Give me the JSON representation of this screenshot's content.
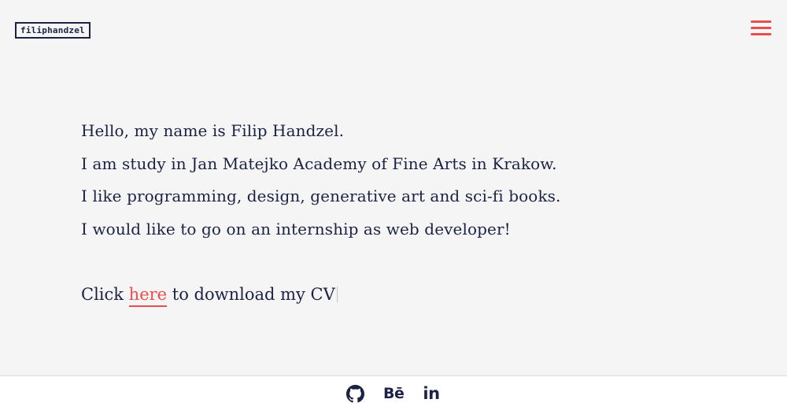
{
  "header": {
    "logo_text": "filiphandzel",
    "menu_icon": "hamburger-menu-icon"
  },
  "intro": {
    "lines": [
      "Hello, my name is Filip Handzel.",
      "I am study in Jan Matejko Academy of Fine Arts in Krakow.",
      "I like programming, design, generative art and sci-fi books.",
      "I would like to go on an internship as web developer!"
    ]
  },
  "cv": {
    "prefix": "Click ",
    "link_text": "here",
    "suffix": " to download my CV"
  },
  "footer": {
    "icons": [
      "github-icon",
      "behance-icon",
      "linkedin-icon"
    ],
    "behance_text": "Bē",
    "linkedin_text": "in"
  },
  "colors": {
    "text": "#1c2245",
    "accent": "#ea4d4d",
    "background": "#f5f5f5",
    "footer_background": "#ffffff"
  }
}
